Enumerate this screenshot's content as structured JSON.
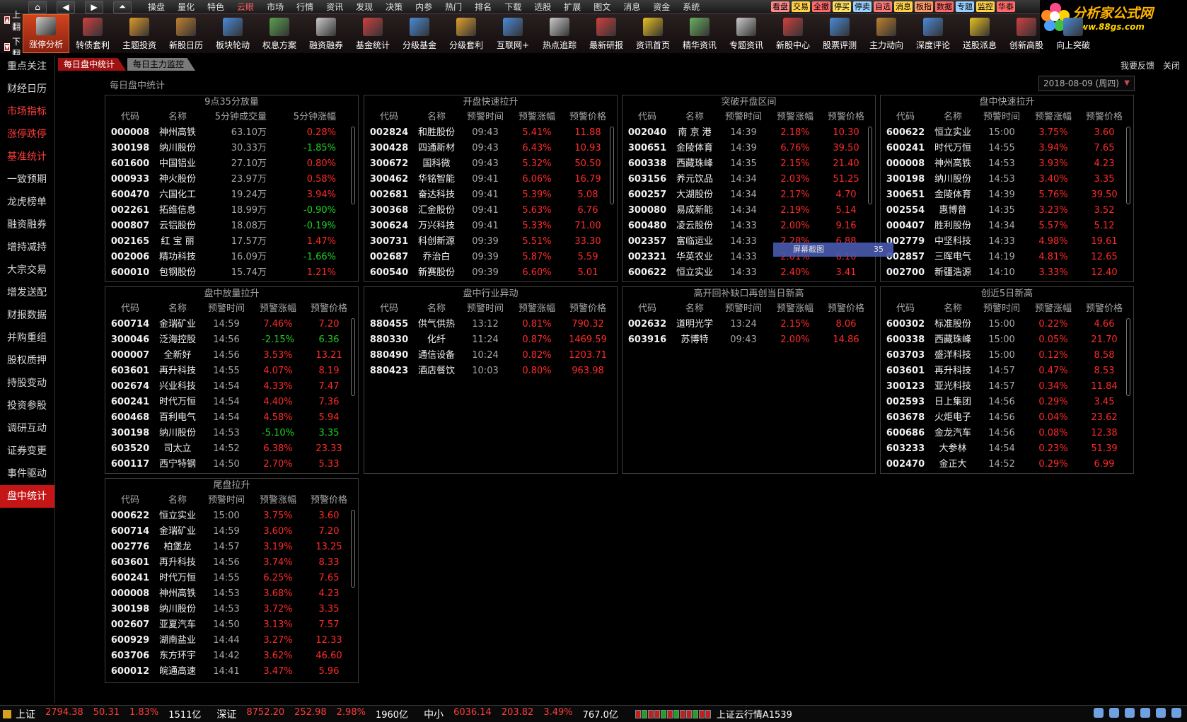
{
  "menu": {
    "nav_icons": [
      "home-icon",
      "back-icon",
      "forward-icon",
      "up-icon"
    ],
    "items": [
      "操盘",
      "量化",
      "特色",
      "云眼",
      "市场",
      "行情",
      "资讯",
      "发现",
      "决策",
      "内参",
      "热门",
      "排名",
      "下载",
      "选股",
      "扩展",
      "图文",
      "消息",
      "资金",
      "系统"
    ],
    "active_index": 3,
    "tags": [
      {
        "label": "看盘",
        "color": "#ff8a8a"
      },
      {
        "label": "交易",
        "color": "#ffd24a"
      },
      {
        "label": "全撤",
        "color": "#ff6a6a"
      },
      {
        "label": "停买",
        "color": "#ffe060"
      },
      {
        "label": "停卖",
        "color": "#9ad0ff"
      },
      {
        "label": "自选",
        "color": "#ff7a7a"
      },
      {
        "label": "消息",
        "color": "#ffd24a"
      },
      {
        "label": "板指",
        "color": "#ff9a6a"
      },
      {
        "label": "数据",
        "color": "#ff6a6a"
      },
      {
        "label": "专题",
        "color": "#9ad0ff"
      },
      {
        "label": "监控",
        "color": "#ffd24a"
      },
      {
        "label": "华泰",
        "color": "#ff6a6a"
      }
    ]
  },
  "logo": {
    "title": "分析家公式网",
    "url": "www.88gs.com"
  },
  "toolbar": {
    "pager": [
      {
        "icon": "up-page-icon",
        "label": "上翻"
      },
      {
        "icon": "down-page-icon",
        "label": "下翻"
      }
    ],
    "items": [
      {
        "label": "涨停分析",
        "icon": "limit-up-icon",
        "color": "#c9c9c9"
      },
      {
        "label": "转债套利",
        "icon": "bond-icon",
        "color": "#d04040"
      },
      {
        "label": "主题投资",
        "icon": "theme-icon",
        "color": "#e09a2a"
      },
      {
        "label": "新股日历",
        "icon": "calendar-icon",
        "color": "#c08030"
      },
      {
        "label": "板块轮动",
        "icon": "sector-icon",
        "color": "#4a8ad8"
      },
      {
        "label": "权息方案",
        "icon": "dividend-icon",
        "color": "#5aa050"
      },
      {
        "label": "融资融券",
        "icon": "margin-icon",
        "color": "#c9c9c9"
      },
      {
        "label": "基金统计",
        "icon": "fund-icon",
        "color": "#d04040"
      },
      {
        "label": "分级基金",
        "icon": "grade-fund-icon",
        "color": "#4a8ad8"
      },
      {
        "label": "分级套利",
        "icon": "arbitrage-icon",
        "color": "#e0a030"
      },
      {
        "label": "互联网+",
        "icon": "internet-icon",
        "color": "#4a8ad8"
      },
      {
        "label": "热点追踪",
        "icon": "hotspot-icon",
        "color": "#c9c9c9"
      },
      {
        "label": "最新研报",
        "icon": "report-icon",
        "color": "#d04040"
      },
      {
        "label": "资讯首页",
        "icon": "medal-icon",
        "color": "#e8c020"
      },
      {
        "label": "精华资讯",
        "icon": "news-icon",
        "color": "#6ab060"
      },
      {
        "label": "专题资讯",
        "icon": "topic-icon",
        "color": "#c9c9c9"
      },
      {
        "label": "新股中心",
        "icon": "ipo-icon",
        "color": "#d04040"
      },
      {
        "label": "股票评测",
        "icon": "rating-icon",
        "color": "#4a8ad8"
      },
      {
        "label": "主力动向",
        "icon": "capital-icon",
        "color": "#c08030"
      },
      {
        "label": "深度评论",
        "icon": "comment-icon",
        "color": "#4a8ad8"
      },
      {
        "label": "送股派息",
        "icon": "bonus-icon",
        "color": "#e8c020"
      },
      {
        "label": "创新高股",
        "icon": "new-high-icon",
        "color": "#d04040"
      },
      {
        "label": "向上突破",
        "icon": "breakout-icon",
        "color": "#4a8ad8"
      }
    ]
  },
  "sidebar": {
    "items": [
      {
        "label": "重点关注",
        "style": ""
      },
      {
        "label": "财经日历",
        "style": ""
      },
      {
        "label": "市场指标",
        "style": "red"
      },
      {
        "label": "涨停跌停",
        "style": "red"
      },
      {
        "label": "基准统计",
        "style": "red"
      },
      {
        "label": "一致预期",
        "style": ""
      },
      {
        "label": "龙虎榜单",
        "style": ""
      },
      {
        "label": "融资融券",
        "style": ""
      },
      {
        "label": "增持减持",
        "style": ""
      },
      {
        "label": "大宗交易",
        "style": ""
      },
      {
        "label": "增发送配",
        "style": ""
      },
      {
        "label": "财报数据",
        "style": ""
      },
      {
        "label": "并购重组",
        "style": ""
      },
      {
        "label": "股权质押",
        "style": ""
      },
      {
        "label": "持股变动",
        "style": ""
      },
      {
        "label": "投资参股",
        "style": ""
      },
      {
        "label": "调研互动",
        "style": ""
      },
      {
        "label": "证券变更",
        "style": ""
      },
      {
        "label": "事件驱动",
        "style": ""
      },
      {
        "label": "盘中统计",
        "style": "active"
      }
    ]
  },
  "tabs": [
    {
      "label": "每日盘中统计",
      "active": true
    },
    {
      "label": "每日主力监控",
      "active": false
    }
  ],
  "header": {
    "feedback": "我要反馈",
    "close": "关闭",
    "title": "每日盘中统计",
    "date": "2018-08-09 (周四)"
  },
  "popup": {
    "label": "屏幕截图",
    "value": "35"
  },
  "panels": [
    {
      "title": "9点35分放量",
      "variant": "vol",
      "headers": [
        "代码",
        "名称",
        "5分钟成交量",
        "5分钟涨幅"
      ],
      "rows": [
        [
          "000008",
          "神州高铁",
          "63.10万",
          "0.28%"
        ],
        [
          "300198",
          "纳川股份",
          "30.33万",
          "-1.85%"
        ],
        [
          "601600",
          "中国铝业",
          "27.10万",
          "0.80%"
        ],
        [
          "000933",
          "神火股份",
          "23.97万",
          "0.58%"
        ],
        [
          "600470",
          "六国化工",
          "19.24万",
          "3.94%"
        ],
        [
          "002261",
          "拓维信息",
          "18.99万",
          "-0.90%"
        ],
        [
          "000807",
          "云铝股份",
          "18.08万",
          "-0.19%"
        ],
        [
          "002165",
          "红 宝 丽",
          "17.57万",
          "1.47%"
        ],
        [
          "002006",
          "精功科技",
          "16.09万",
          "-1.66%"
        ],
        [
          "600010",
          "包钢股份",
          "15.74万",
          "1.21%"
        ]
      ]
    },
    {
      "title": "开盘快速拉升",
      "variant": "std",
      "headers": [
        "代码",
        "名称",
        "预警时间",
        "预警涨幅",
        "预警价格"
      ],
      "rows": [
        [
          "002824",
          "和胜股份",
          "09:43",
          "5.41%",
          "11.88"
        ],
        [
          "300428",
          "四通新材",
          "09:43",
          "6.43%",
          "10.93"
        ],
        [
          "300672",
          "国科微",
          "09:43",
          "5.32%",
          "50.50"
        ],
        [
          "300462",
          "华铭智能",
          "09:41",
          "6.06%",
          "16.79"
        ],
        [
          "002681",
          "奋达科技",
          "09:41",
          "5.39%",
          "5.08"
        ],
        [
          "300368",
          "汇金股份",
          "09:41",
          "5.63%",
          "6.76"
        ],
        [
          "300624",
          "万兴科技",
          "09:41",
          "5.33%",
          "71.00"
        ],
        [
          "300731",
          "科创新源",
          "09:39",
          "5.51%",
          "33.30"
        ],
        [
          "002687",
          "乔治白",
          "09:39",
          "5.87%",
          "5.59"
        ],
        [
          "600540",
          "新赛股份",
          "09:39",
          "6.60%",
          "5.01"
        ]
      ]
    },
    {
      "title": "突破开盘区间",
      "variant": "std",
      "headers": [
        "代码",
        "名称",
        "预警时间",
        "预警涨幅",
        "预警价格"
      ],
      "rows": [
        [
          "002040",
          "南 京 港",
          "14:39",
          "2.18%",
          "10.30"
        ],
        [
          "300651",
          "金陵体育",
          "14:39",
          "6.76%",
          "39.50"
        ],
        [
          "600338",
          "西藏珠峰",
          "14:35",
          "2.15%",
          "21.40"
        ],
        [
          "603156",
          "养元饮品",
          "14:34",
          "2.03%",
          "51.25"
        ],
        [
          "600257",
          "大湖股份",
          "14:34",
          "2.17%",
          "4.70"
        ],
        [
          "300080",
          "易成新能",
          "14:34",
          "2.19%",
          "5.14"
        ],
        [
          "600480",
          "凌云股份",
          "14:33",
          "2.00%",
          "9.16"
        ],
        [
          "002357",
          "富临运业",
          "14:33",
          "2.28%",
          "6.88"
        ],
        [
          "002321",
          "华英农业",
          "14:33",
          "2.01%",
          "6.10"
        ],
        [
          "600622",
          "恒立实业",
          "14:33",
          "2.40%",
          "3.41"
        ]
      ]
    },
    {
      "title": "盘中快速拉升",
      "variant": "std",
      "headers": [
        "代码",
        "名称",
        "预警时间",
        "预警涨幅",
        "预警价格"
      ],
      "rows": [
        [
          "600622",
          "恒立实业",
          "15:00",
          "3.75%",
          "3.60"
        ],
        [
          "600241",
          "时代万恒",
          "14:55",
          "3.94%",
          "7.65"
        ],
        [
          "000008",
          "神州高铁",
          "14:53",
          "3.93%",
          "4.23"
        ],
        [
          "300198",
          "纳川股份",
          "14:53",
          "3.40%",
          "3.35"
        ],
        [
          "300651",
          "金陵体育",
          "14:39",
          "5.76%",
          "39.50"
        ],
        [
          "002554",
          "惠博普",
          "14:35",
          "3.23%",
          "3.52"
        ],
        [
          "000407",
          "胜利股份",
          "14:34",
          "5.57%",
          "5.12"
        ],
        [
          "002779",
          "中坚科技",
          "14:33",
          "4.98%",
          "19.61"
        ],
        [
          "002857",
          "三晖电气",
          "14:19",
          "4.81%",
          "12.65"
        ],
        [
          "002700",
          "新疆浩源",
          "14:10",
          "3.33%",
          "12.40"
        ]
      ]
    },
    {
      "title": "盘中放量拉升",
      "variant": "std",
      "headers": [
        "代码",
        "名称",
        "预警时间",
        "预警涨幅",
        "预警价格"
      ],
      "rows": [
        [
          "600714",
          "金瑞矿业",
          "14:59",
          "7.46%",
          "7.20"
        ],
        [
          "300046",
          "泛海控股",
          "14:56",
          "-2.15%",
          "6.36"
        ],
        [
          "000007",
          "全新好",
          "14:56",
          "3.53%",
          "13.21"
        ],
        [
          "603601",
          "再升科技",
          "14:55",
          "4.07%",
          "8.19"
        ],
        [
          "002674",
          "兴业科技",
          "14:54",
          "4.33%",
          "7.47"
        ],
        [
          "600241",
          "时代万恒",
          "14:54",
          "4.40%",
          "7.36"
        ],
        [
          "600468",
          "百利电气",
          "14:54",
          "4.58%",
          "5.94"
        ],
        [
          "300198",
          "纳川股份",
          "14:53",
          "-5.10%",
          "3.35"
        ],
        [
          "603520",
          "司太立",
          "14:52",
          "6.38%",
          "23.33"
        ],
        [
          "600117",
          "西宁特钢",
          "14:50",
          "2.70%",
          "5.33"
        ]
      ]
    },
    {
      "title": "盘中行业异动",
      "variant": "std",
      "headers": [
        "代码",
        "名称",
        "预警时间",
        "预警涨幅",
        "预警价格"
      ],
      "rows": [
        [
          "880455",
          "供气供热",
          "13:12",
          "0.81%",
          "790.32"
        ],
        [
          "880330",
          "化纤",
          "11:24",
          "0.87%",
          "1469.59"
        ],
        [
          "880490",
          "通信设备",
          "10:24",
          "0.82%",
          "1203.71"
        ],
        [
          "880423",
          "酒店餐饮",
          "10:03",
          "0.80%",
          "963.98"
        ]
      ]
    },
    {
      "title": "高开回补缺口再创当日新高",
      "variant": "std",
      "headers": [
        "代码",
        "名称",
        "预警时间",
        "预警涨幅",
        "预警价格"
      ],
      "rows": [
        [
          "002632",
          "道明光学",
          "13:24",
          "2.15%",
          "8.06"
        ],
        [
          "603916",
          "苏博特",
          "09:43",
          "2.00%",
          "14.86"
        ]
      ]
    },
    {
      "title": "创近5日新高",
      "variant": "std",
      "headers": [
        "代码",
        "名称",
        "预警时间",
        "预警涨幅",
        "预警价格"
      ],
      "rows": [
        [
          "600302",
          "标准股份",
          "15:00",
          "0.22%",
          "4.66"
        ],
        [
          "600338",
          "西藏珠峰",
          "15:00",
          "0.05%",
          "21.70"
        ],
        [
          "603703",
          "盛洋科技",
          "15:00",
          "0.12%",
          "8.58"
        ],
        [
          "603601",
          "再升科技",
          "14:57",
          "0.47%",
          "8.53"
        ],
        [
          "300123",
          "亚光科技",
          "14:57",
          "0.34%",
          "11.84"
        ],
        [
          "002593",
          "日上集团",
          "14:56",
          "0.29%",
          "3.45"
        ],
        [
          "603678",
          "火炬电子",
          "14:56",
          "0.04%",
          "23.62"
        ],
        [
          "600686",
          "金龙汽车",
          "14:56",
          "0.08%",
          "12.38"
        ],
        [
          "603233",
          "大参林",
          "14:54",
          "0.23%",
          "51.39"
        ],
        [
          "002470",
          "金正大",
          "14:52",
          "0.29%",
          "6.99"
        ]
      ]
    },
    {
      "title": "尾盘拉升",
      "variant": "std",
      "headers": [
        "代码",
        "名称",
        "预警时间",
        "预警涨幅",
        "预警价格"
      ],
      "rows": [
        [
          "000622",
          "恒立实业",
          "15:00",
          "3.75%",
          "3.60"
        ],
        [
          "600714",
          "金瑞矿业",
          "14:59",
          "3.60%",
          "7.20"
        ],
        [
          "002776",
          "柏堡龙",
          "14:57",
          "3.19%",
          "13.25"
        ],
        [
          "603601",
          "再升科技",
          "14:56",
          "3.74%",
          "8.33"
        ],
        [
          "600241",
          "时代万恒",
          "14:55",
          "6.25%",
          "7.65"
        ],
        [
          "000008",
          "神州高铁",
          "14:53",
          "3.68%",
          "4.23"
        ],
        [
          "300198",
          "纳川股份",
          "14:53",
          "3.72%",
          "3.35"
        ],
        [
          "002607",
          "亚夏汽车",
          "14:50",
          "3.13%",
          "7.57"
        ],
        [
          "600929",
          "湖南盐业",
          "14:44",
          "3.27%",
          "12.33"
        ],
        [
          "603706",
          "东方环宇",
          "14:42",
          "3.62%",
          "46.60"
        ],
        [
          "600012",
          "皖通高速",
          "14:41",
          "3.47%",
          "5.96"
        ]
      ]
    }
  ],
  "statusbar": {
    "indices": [
      {
        "name": "上证",
        "value": "2794.38",
        "change": "50.31",
        "pct": "1.83%",
        "amount": "1511亿"
      },
      {
        "name": "深证",
        "value": "8752.20",
        "change": "252.98",
        "pct": "2.98%",
        "amount": "1960亿"
      },
      {
        "name": "中小",
        "value": "6036.14",
        "change": "203.82",
        "pct": "3.49%",
        "amount": "767.0亿"
      }
    ],
    "server": "上证云行情A1539",
    "tray_icons": [
      "checkbox-icon",
      "ime-icon",
      "moon-icon",
      "dots-icon",
      "user-icon",
      "settings-icon"
    ]
  }
}
